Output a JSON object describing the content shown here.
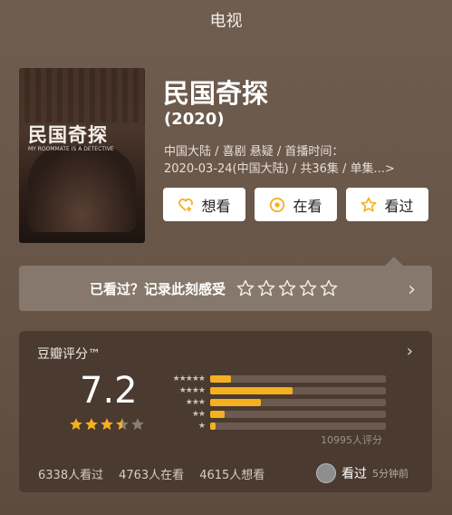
{
  "topbar": {
    "title": "电视"
  },
  "poster": {
    "title": "民国奇探",
    "subtitle": "MY ROOMMATE IS A DETECTIVE"
  },
  "movie": {
    "title": "民国奇探",
    "year": "(2020)",
    "meta_line1": "中国大陆 / 喜剧 悬疑 / 首播时间：",
    "meta_line2": "2020-03-24(中国大陆) / 共36集 / 单集...>"
  },
  "actions": [
    {
      "label": "想看",
      "icon": "heart-plus-icon"
    },
    {
      "label": "在看",
      "icon": "target-icon"
    },
    {
      "label": "看过",
      "icon": "star-outline-icon"
    }
  ],
  "record": {
    "text": "已看过？记录此刻感受",
    "stars_count": 5
  },
  "rating": {
    "header": "豆瓣评分™",
    "score": "7.2",
    "stars_value": 3.5,
    "distribution": [
      {
        "stars": "★★★★★",
        "value": 0.12
      },
      {
        "stars": "★★★★",
        "value": 0.47
      },
      {
        "stars": "★★★",
        "value": 0.29
      },
      {
        "stars": "★★",
        "value": 0.08
      },
      {
        "stars": "★",
        "value": 0.03
      }
    ],
    "count_text": "10995人评分",
    "watched": "6338人看过",
    "watching": "4763人在看",
    "wish": "4615人想看",
    "friend_label": "看过",
    "friend_time": "5分钟前"
  },
  "colors": {
    "accent": "#f5b01f",
    "background": "#6b5a4d",
    "card": "#4a3a30"
  }
}
